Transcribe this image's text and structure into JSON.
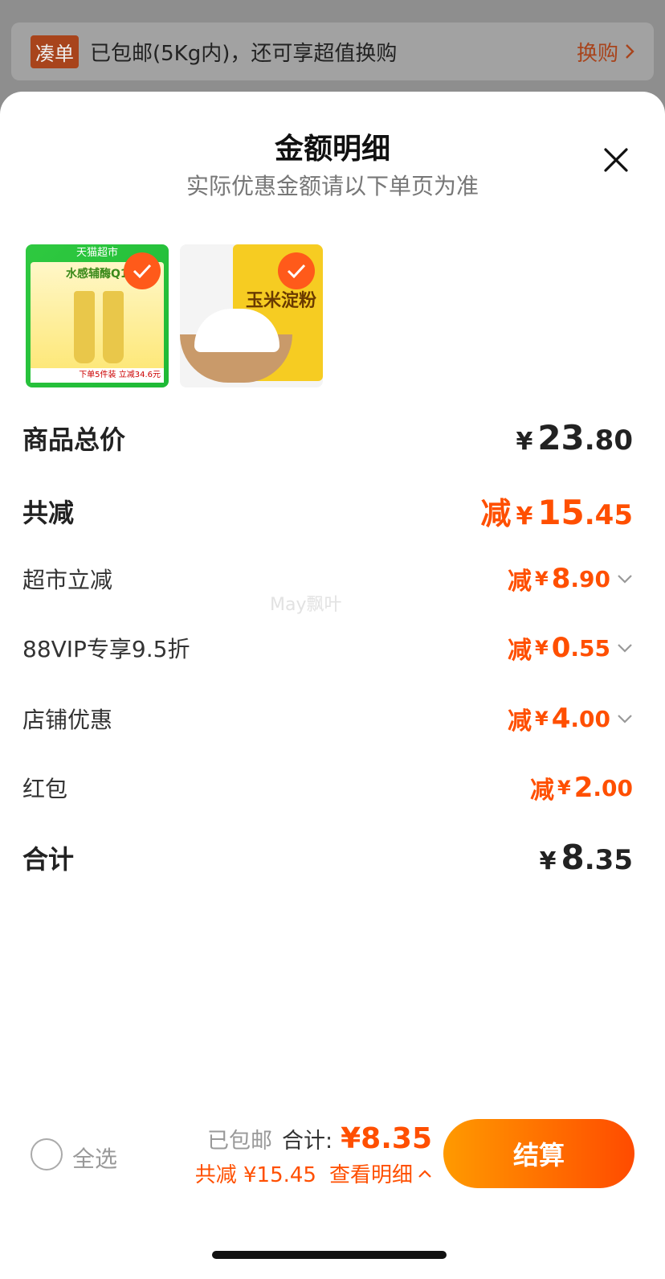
{
  "banner": {
    "tag": "凑单",
    "text": "已包邮(5Kg内)，还可享超值换购",
    "link": "换购"
  },
  "sheet": {
    "title": "金额明细",
    "subtitle": "实际优惠金额请以下单页为准"
  },
  "products": [
    {
      "name": "tmall-lotion",
      "bar_text": "天猫超市",
      "headline": "水感辅酶Q1",
      "foot_text": "下单5件装 立减34.6元"
    },
    {
      "name": "corn-starch",
      "bag_text": "玉米淀粉"
    }
  ],
  "rows": {
    "goods_total": {
      "label": "商品总价",
      "yen": "¥",
      "int": "23",
      "dec": ".80"
    },
    "total_reduce": {
      "label": "共减",
      "prefix": "减",
      "yen": "¥",
      "int": "15",
      "dec": ".45"
    },
    "market": {
      "label": "超市立减",
      "prefix": "减",
      "yen": "¥",
      "int": "8",
      "dec": ".90"
    },
    "vip": {
      "label": "88VIP专享9.5折",
      "prefix": "减",
      "yen": "¥",
      "int": "0",
      "dec": ".55"
    },
    "shop": {
      "label": "店铺优惠",
      "prefix": "减",
      "yen": "¥",
      "int": "4",
      "dec": ".00"
    },
    "redpacket": {
      "label": "红包",
      "prefix": "减",
      "yen": "¥",
      "int": "2",
      "dec": ".00"
    },
    "sum": {
      "label": "合计",
      "yen": "¥",
      "int": "8",
      "dec": ".35"
    }
  },
  "watermark": "May飘叶",
  "bottom": {
    "select_all": "全选",
    "shipping": "已包邮",
    "total_label": "合计:",
    "total_value": "¥8.35",
    "reduce_text": "共减 ¥15.45",
    "detail_link": "查看明细",
    "checkout": "结算"
  }
}
